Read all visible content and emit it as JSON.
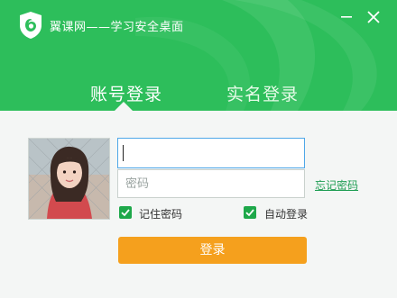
{
  "window": {
    "title": "翼课网——学习安全桌面",
    "minimize_icon": "minimize-icon",
    "close_icon": "close-icon"
  },
  "colors": {
    "header_green": "#2dbe5b",
    "link_green": "#1d9d52",
    "checkbox_green": "#1ea84a",
    "login_orange": "#f5a01d"
  },
  "tabs": [
    {
      "label": "账号登录",
      "active": true
    },
    {
      "label": "实名登录",
      "active": false
    }
  ],
  "form": {
    "username_value": "",
    "password_placeholder": "密码",
    "forgot_password": "忘记密码",
    "remember_password": "记住密码",
    "remember_checked": true,
    "auto_login": "自动登录",
    "auto_checked": true,
    "login_button": "登录"
  }
}
